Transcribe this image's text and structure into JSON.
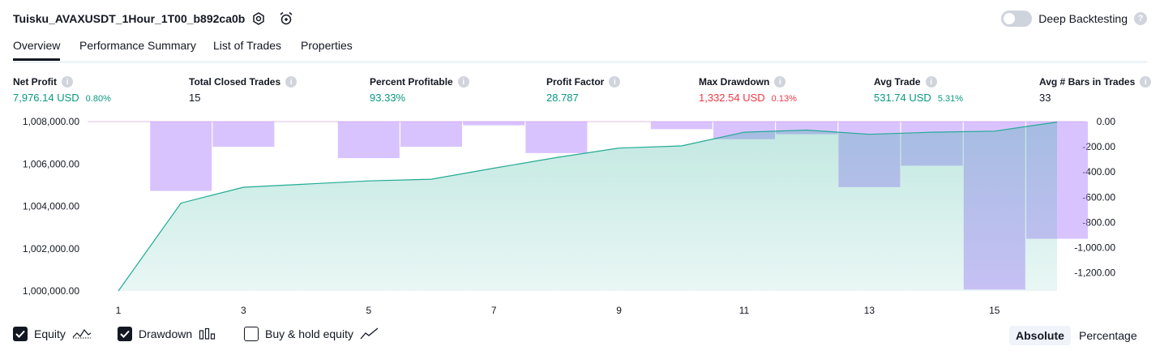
{
  "header": {
    "strategy_title": "Tuisku_AVAXUSDT_1Hour_1T00_b892ca0b",
    "settings_icon": "gear-icon",
    "alert_icon": "alarm-clock-icon",
    "deep_backtesting_label": "Deep Backtesting",
    "deep_backtesting_enabled": false,
    "help_icon": "question-icon"
  },
  "tabs": [
    {
      "label": "Overview",
      "active": true
    },
    {
      "label": "Performance Summary",
      "active": false
    },
    {
      "label": "List of Trades",
      "active": false
    },
    {
      "label": "Properties",
      "active": false
    }
  ],
  "metrics": [
    {
      "label": "Net Profit",
      "value": "7,976.14 USD",
      "pct": "0.80%",
      "color": "green"
    },
    {
      "label": "Total Closed Trades",
      "value": "15",
      "pct": "",
      "color": "default"
    },
    {
      "label": "Percent Profitable",
      "value": "93.33%",
      "pct": "",
      "color": "green"
    },
    {
      "label": "Profit Factor",
      "value": "28.787",
      "pct": "",
      "color": "green"
    },
    {
      "label": "Max Drawdown",
      "value": "1,332.54 USD",
      "pct": "0.13%",
      "color": "red"
    },
    {
      "label": "Avg Trade",
      "value": "531.74 USD",
      "pct": "5.31%",
      "color": "green"
    },
    {
      "label": "Avg # Bars in Trades",
      "value": "33",
      "pct": "",
      "color": "default"
    }
  ],
  "chart_data": {
    "type": "area",
    "x_ticks": [
      "1",
      "3",
      "5",
      "7",
      "9",
      "11",
      "13",
      "15"
    ],
    "left_axis": {
      "ticks": [
        "1,008,000.00",
        "1,006,000.00",
        "1,004,000.00",
        "1,002,000.00",
        "1,000,000.00"
      ],
      "ylim": [
        1000000,
        1008000
      ]
    },
    "right_axis": {
      "ticks": [
        "0.00",
        "-200.00",
        "-400.00",
        "-600.00",
        "-800.00",
        "-1,000.00",
        "-1,200.00"
      ],
      "ylim": [
        -1332.54,
        0
      ]
    },
    "series": [
      {
        "name": "Equity",
        "type": "area",
        "color": "#22ab94",
        "x": [
          1,
          2,
          3,
          4,
          5,
          6,
          7,
          8,
          9,
          10,
          11,
          12,
          13,
          14,
          15,
          16
        ],
        "values": [
          1000000,
          1004150,
          1004900,
          1005050,
          1005200,
          1005280,
          1005800,
          1006300,
          1006750,
          1006850,
          1007500,
          1007600,
          1007400,
          1007500,
          1007550,
          1007976
        ]
      },
      {
        "name": "Drawdown",
        "type": "bar",
        "color": "#b388ff",
        "x": [
          1,
          2,
          3,
          4,
          5,
          6,
          7,
          8,
          9,
          10,
          11,
          12,
          13,
          14,
          15,
          16
        ],
        "values": [
          0,
          -550,
          -200,
          0,
          -290,
          -200,
          -30,
          -250,
          0,
          -60,
          -140,
          -100,
          -520,
          -350,
          -1332.54,
          -930
        ]
      }
    ]
  },
  "legend": {
    "equity": {
      "label": "Equity",
      "checked": true,
      "icon": "equity-line-icon"
    },
    "drawdown": {
      "label": "Drawdown",
      "checked": true,
      "icon": "bar-chart-icon"
    },
    "buy_hold": {
      "label": "Buy & hold equity",
      "checked": false,
      "icon": "line-chart-icon"
    }
  },
  "modes": {
    "absolute": "Absolute",
    "percentage": "Percentage",
    "active": "absolute"
  }
}
